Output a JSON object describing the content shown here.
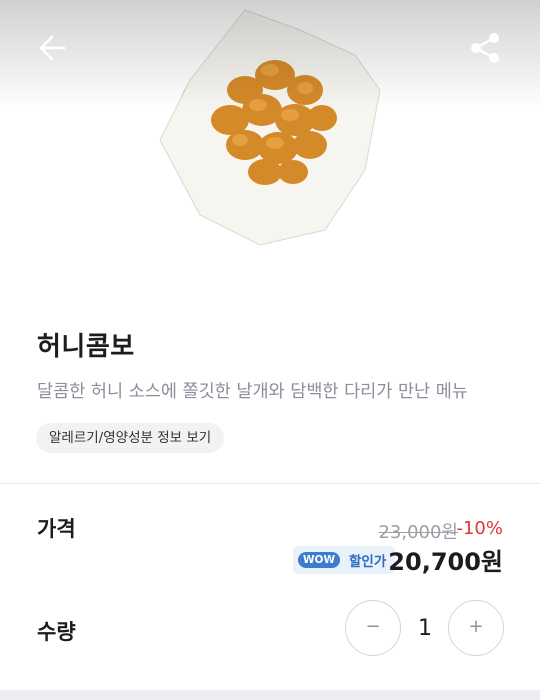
{
  "header": {
    "back_icon": "arrow-left-icon",
    "share_icon": "share-icon"
  },
  "product": {
    "image": "honey-combo-fried-chicken-photo",
    "name": "허니콤보",
    "description": "달콤한 허니 소스에 쫄깃한 날개와 담백한 다리가 만난 메뉴",
    "info_button_label": "알레르기/영양성분 정보 보기"
  },
  "price": {
    "label": "가격",
    "original": "23,000원",
    "discount": "-10%",
    "badge_pill": "WOW",
    "badge_text": "할인가",
    "sale": "20,700원"
  },
  "quantity": {
    "label": "수량",
    "minus_label": "−",
    "value": "1",
    "plus_label": "+"
  },
  "colors": {
    "discount": "#d93a36",
    "wow_blue": "#3f7ccc",
    "wow_bg": "#e9f1fb"
  }
}
